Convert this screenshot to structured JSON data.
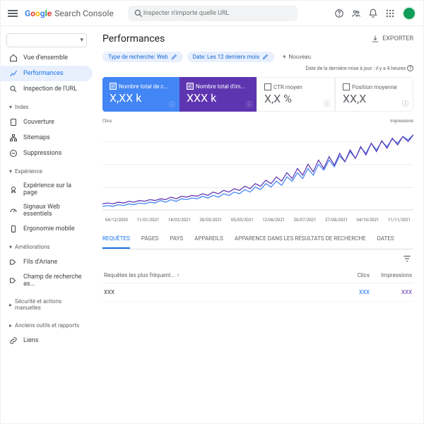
{
  "header": {
    "product": "Search Console",
    "search_placeholder": "Inspecter n'importe quelle URL"
  },
  "sidebar": {
    "overview": "Vue d'ensemble",
    "performance": "Performances",
    "inspect": "Inspection de l'URL",
    "index_hdr": "Index",
    "coverage": "Couverture",
    "sitemaps": "Sitemaps",
    "removals": "Suppressions",
    "exp_hdr": "Expérience",
    "pageexp": "Expérience sur la page",
    "cw": "Signaux Web essentiels",
    "mobile": "Ergonomie mobile",
    "enh_hdr": "Améliorations",
    "bread": "Fils d'Ariane",
    "search_field": "Champ de recherche as...",
    "sec_hdr": "Sécurité et actions manuelles",
    "legacy_hdr": "Anciens outils et rapports",
    "links": "Liens"
  },
  "page": {
    "title": "Performances",
    "export": "EXPORTER",
    "filters": {
      "type": "Type de recherche: Web",
      "date": "Date: Les 12 derniers mois",
      "new": "Nouveau"
    },
    "updated": "Date de la dernière mise à jour : il y a 4 heures",
    "metrics": {
      "clicks": {
        "label": "Nombre total de c...",
        "value": "X,XX k"
      },
      "impr": {
        "label": "Nombre total d'im...",
        "value": "XXX k"
      },
      "ctr": {
        "label": "CTR moyen",
        "value": "X,X %"
      },
      "pos": {
        "label": "Position moyenne",
        "value": "XX,X"
      }
    },
    "chart": {
      "left": "Clics",
      "right": "Impressions"
    },
    "tabs": {
      "q": "REQUÊTES",
      "p": "PAGES",
      "c": "PAYS",
      "d": "APPAREILS",
      "a": "APPARENCE DANS LES RÉSULTATS DE RECHERCHE",
      "dt": "DATES"
    },
    "table": {
      "h1": "Requêtes les plus fréquent...",
      "h2": "Clics",
      "h3": "Impressions",
      "rows": [
        {
          "q": "XXX",
          "clicks": "XXX",
          "impr": "XXX"
        }
      ]
    }
  },
  "chart_data": {
    "type": "line",
    "xlabel": "",
    "ylabel_left": "Clics",
    "ylabel_right": "Impressions",
    "x": [
      "04/12/2020",
      "11/01/2021",
      "18/02/2021",
      "28/03/2021",
      "05/05/2021",
      "12/06/2021",
      "20/07/2021",
      "27/08/2021",
      "04/10/2021",
      "11/11/2021"
    ],
    "series": [
      {
        "name": "Clics",
        "color": "#4285f4",
        "values": [
          5,
          6,
          5,
          7,
          6,
          8,
          7,
          9,
          8,
          10,
          9,
          12,
          10,
          13,
          11,
          14,
          13,
          15,
          14,
          17,
          15,
          18,
          16,
          20,
          18,
          22,
          20,
          25,
          22,
          28,
          25,
          32,
          28,
          35,
          30,
          40,
          35,
          45,
          38,
          50,
          42,
          55,
          48,
          60,
          52,
          65,
          58,
          70,
          62,
          75,
          68,
          80,
          72,
          82,
          76,
          85,
          80,
          88,
          84,
          90
        ]
      },
      {
        "name": "Impressions",
        "color": "#5e35b1",
        "values": [
          8,
          9,
          8,
          10,
          9,
          11,
          10,
          12,
          11,
          13,
          12,
          14,
          13,
          16,
          14,
          17,
          16,
          18,
          17,
          20,
          18,
          22,
          20,
          24,
          22,
          26,
          24,
          29,
          26,
          32,
          29,
          36,
          32,
          40,
          35,
          45,
          38,
          50,
          42,
          55,
          46,
          60,
          50,
          64,
          54,
          68,
          58,
          72,
          62,
          76,
          66,
          80,
          70,
          83,
          74,
          86,
          78,
          88,
          82,
          90
        ]
      }
    ]
  }
}
